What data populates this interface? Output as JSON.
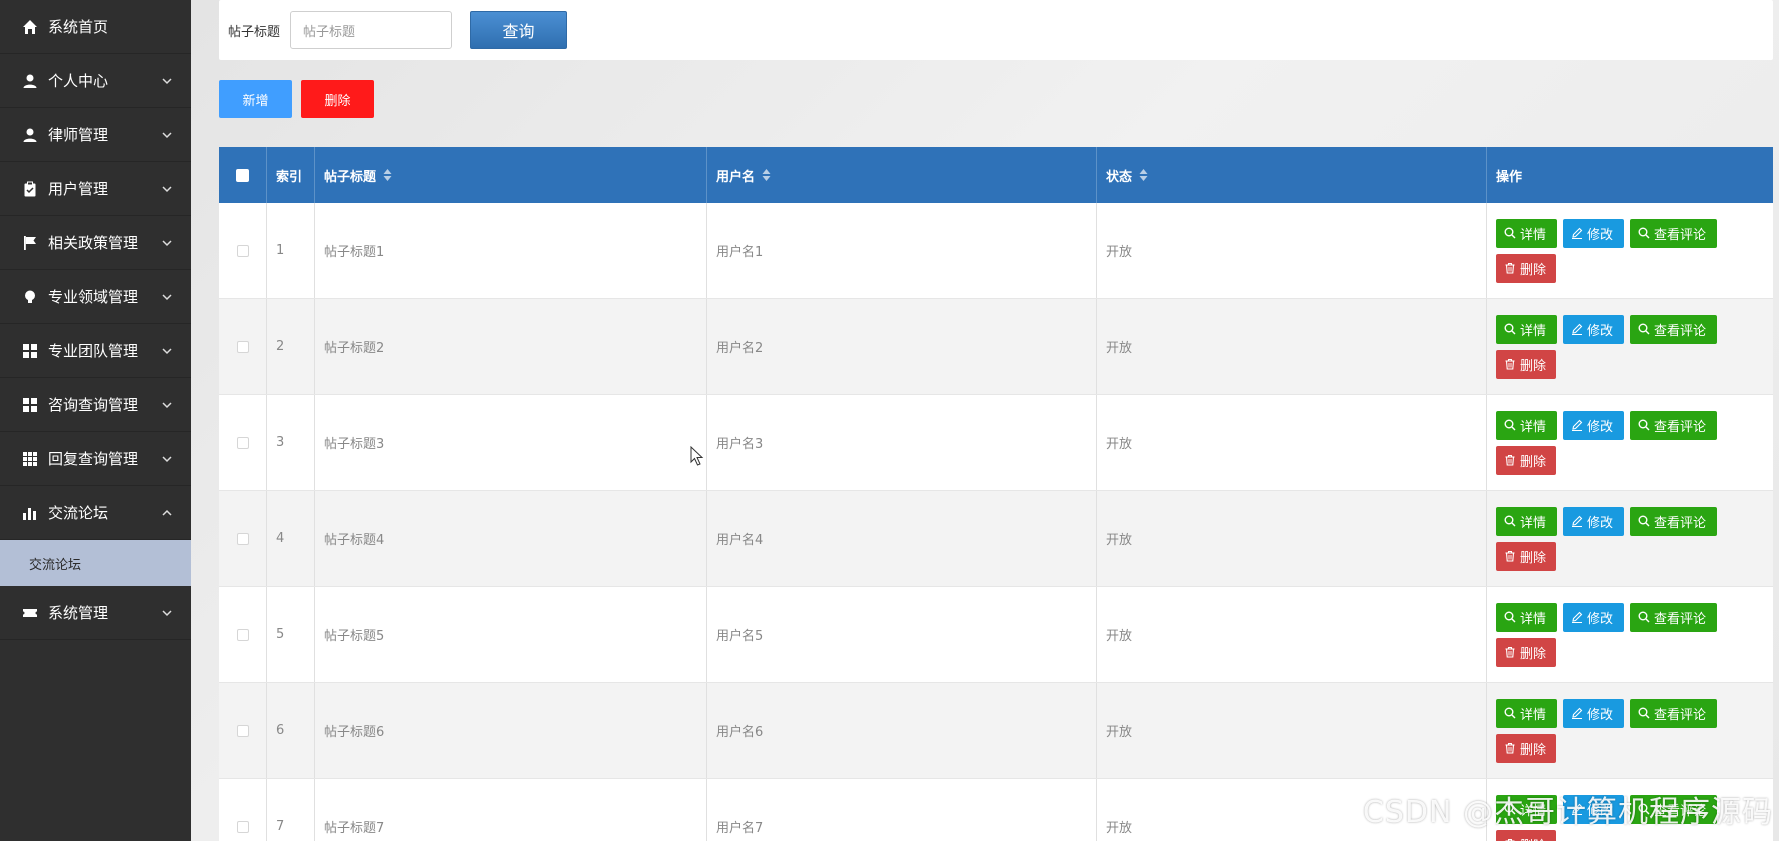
{
  "sidebar": {
    "items": [
      {
        "label": "系统首页",
        "icon": "home-icon",
        "has_children": false
      },
      {
        "label": "个人中心",
        "icon": "user-icon",
        "has_children": true
      },
      {
        "label": "律师管理",
        "icon": "user-icon",
        "has_children": true
      },
      {
        "label": "用户管理",
        "icon": "clipboard-icon",
        "has_children": true
      },
      {
        "label": "相关政策管理",
        "icon": "flag-icon",
        "has_children": true
      },
      {
        "label": "专业领域管理",
        "icon": "bulb-icon",
        "has_children": true
      },
      {
        "label": "专业团队管理",
        "icon": "grid-icon",
        "has_children": true
      },
      {
        "label": "咨询查询管理",
        "icon": "grid-icon",
        "has_children": true
      },
      {
        "label": "回复查询管理",
        "icon": "apps-icon",
        "has_children": true
      },
      {
        "label": "交流论坛",
        "icon": "bar-chart-icon",
        "has_children": true,
        "expanded": true
      },
      {
        "label": "系统管理",
        "icon": "ticket-icon",
        "has_children": true
      }
    ],
    "submenu": {
      "label": "交流论坛"
    }
  },
  "search": {
    "label": "帖子标题",
    "placeholder": "帖子标题",
    "button": "查询"
  },
  "actions": {
    "add": "新增",
    "delete": "删除"
  },
  "table": {
    "headers": {
      "index": "索引",
      "title": "帖子标题",
      "username": "用户名",
      "status": "状态",
      "ops": "操作"
    },
    "op_labels": {
      "detail": "详情",
      "edit": "修改",
      "comments": "查看评论",
      "remove": "删除"
    },
    "rows": [
      {
        "index": "1",
        "title": "帖子标题1",
        "username": "用户名1",
        "status": "开放"
      },
      {
        "index": "2",
        "title": "帖子标题2",
        "username": "用户名2",
        "status": "开放"
      },
      {
        "index": "3",
        "title": "帖子标题3",
        "username": "用户名3",
        "status": "开放"
      },
      {
        "index": "4",
        "title": "帖子标题4",
        "username": "用户名4",
        "status": "开放"
      },
      {
        "index": "5",
        "title": "帖子标题5",
        "username": "用户名5",
        "status": "开放"
      },
      {
        "index": "6",
        "title": "帖子标题6",
        "username": "用户名6",
        "status": "开放"
      },
      {
        "index": "7",
        "title": "帖子标题7",
        "username": "用户名7",
        "status": "开放"
      }
    ]
  },
  "watermark": "CSDN @杰哥计算机程序源码",
  "colors": {
    "sidebar_bg": "#2f2f2f",
    "submenu_bg": "#b3bfd6",
    "header_blue": "#2f72b8",
    "add_blue": "#409eff",
    "delete_red": "#ff1a1a",
    "op_green": "#2aa512",
    "op_blue": "#199ae0",
    "op_red": "#d14545"
  }
}
